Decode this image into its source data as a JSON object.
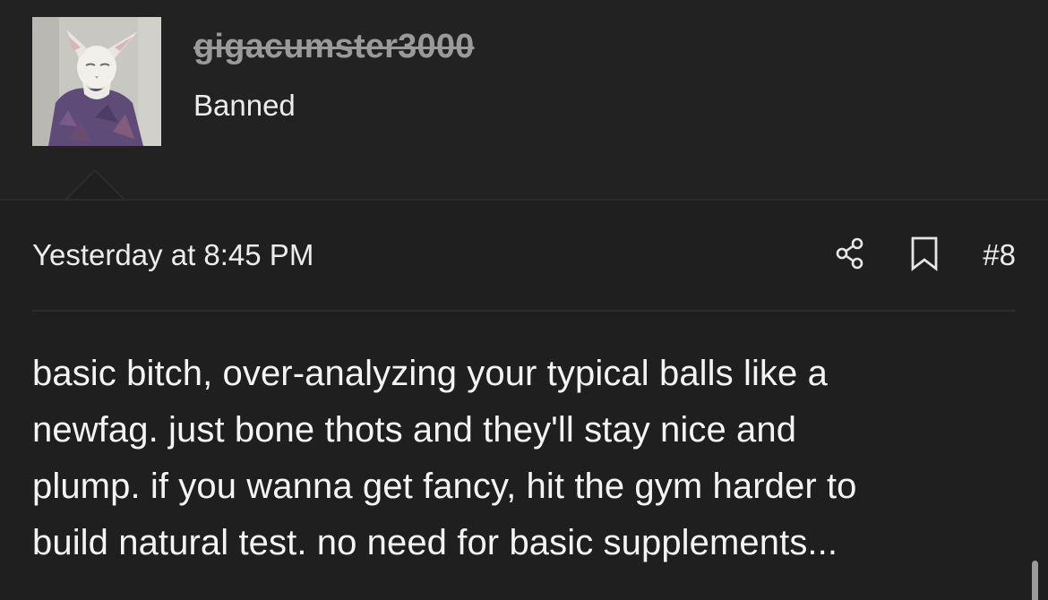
{
  "user": {
    "username": "gigacumster3000",
    "title": "Banned",
    "avatar_icon": "cat-avatar"
  },
  "post": {
    "timestamp": "Yesterday at 8:45 PM",
    "share_icon": "share-icon",
    "bookmark_icon": "bookmark-icon",
    "number": "#8",
    "body_lines": [
      "basic bitch, over-analyzing your typical balls like a",
      "newfag. just bone thots and they'll stay nice and",
      "plump. if you wanna get fancy, hit the gym harder to",
      "build natural test. no need for basic supplements..."
    ]
  },
  "colors": {
    "background": "#1f1f1f",
    "header_background": "#222222",
    "text": "#f2f2f2",
    "username_struck": "#9a9a9a"
  }
}
